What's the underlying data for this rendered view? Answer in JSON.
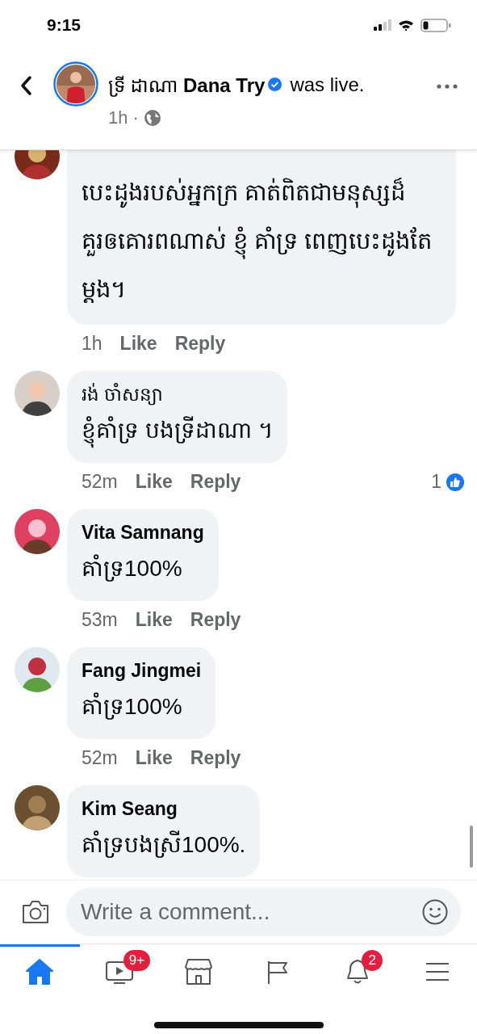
{
  "status_bar": {
    "time": "9:15"
  },
  "header": {
    "page_name_khmer": "ទ្រី ដាណា",
    "page_name": "Dana Try",
    "action": "was live.",
    "time": "1h",
    "separator": "·"
  },
  "comments": [
    {
      "text": "បេះដូងរបស់អ្នកក្រ គាត់ពិតជាមនុស្សដ៏គួរឲគោរពណាស់ ខ្ញុំ គាំទ្រ ពេញបេះដូងតែម្តង។",
      "time": "1h",
      "like": "Like",
      "reply": "Reply"
    },
    {
      "author": "រង់ ចាំសន្យា",
      "text": "ខ្ញុំគាំទ្រ បងទ្រីដាណា ។",
      "time": "52m",
      "like": "Like",
      "reply": "Reply",
      "reactions": "1"
    },
    {
      "author": "Vita Samnang",
      "text": "គាំទ្រ100%",
      "time": "53m",
      "like": "Like",
      "reply": "Reply"
    },
    {
      "author": "Fang Jingmei",
      "text": "គាំទ្រ100%",
      "time": "52m",
      "like": "Like",
      "reply": "Reply"
    },
    {
      "author": "Kim Seang",
      "text": "គាំទ្របងស្រី100%."
    }
  ],
  "composer": {
    "placeholder": "Write a comment..."
  },
  "tabs": [
    {
      "kind": "home",
      "selected": true
    },
    {
      "kind": "video",
      "selected": false,
      "badge": "9+"
    },
    {
      "kind": "marketplace",
      "selected": false
    },
    {
      "kind": "pages",
      "selected": false
    },
    {
      "kind": "notifications",
      "selected": false,
      "badge": "2"
    },
    {
      "kind": "menu",
      "selected": false
    }
  ]
}
